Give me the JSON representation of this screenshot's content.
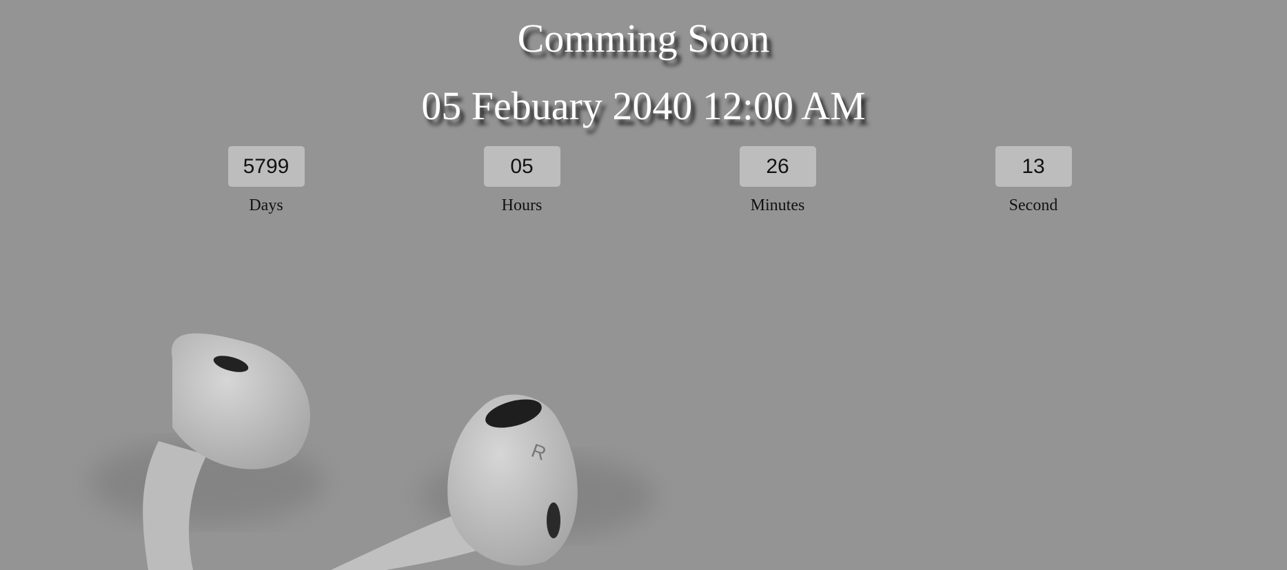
{
  "heading": "Comming Soon",
  "launch_date": "05 Febuary 2040 12:00 AM",
  "countdown": [
    {
      "value": "5799",
      "label": "Days"
    },
    {
      "value": "05",
      "label": "Hours"
    },
    {
      "value": "26",
      "label": "Minutes"
    },
    {
      "value": "13",
      "label": "Second"
    }
  ],
  "colors": {
    "background": "#949494",
    "box": "#bdbdbd",
    "heading": "#ffffff"
  }
}
